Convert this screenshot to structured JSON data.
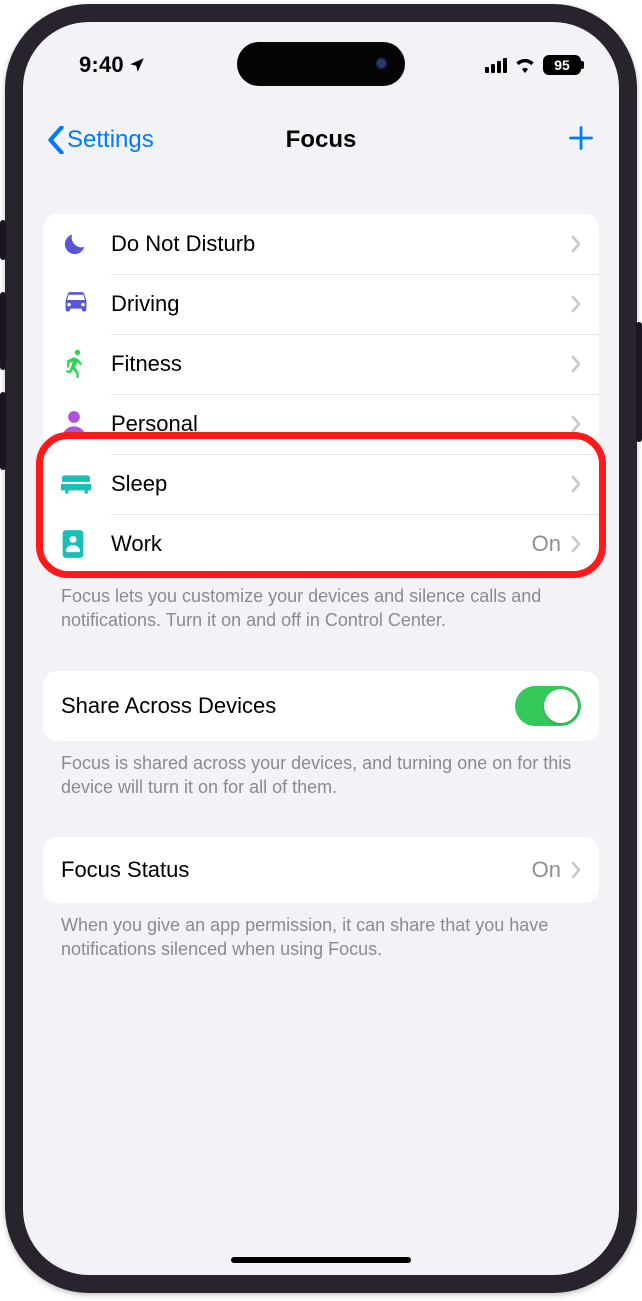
{
  "status": {
    "time": "9:40",
    "battery": "95"
  },
  "nav": {
    "back": "Settings",
    "title": "Focus"
  },
  "focus_list": [
    {
      "icon": "moon",
      "label": "Do Not Disturb",
      "detail": "",
      "color": "#5856d6"
    },
    {
      "icon": "car",
      "label": "Driving",
      "detail": "",
      "color": "#5856d6"
    },
    {
      "icon": "runner",
      "label": "Fitness",
      "detail": "",
      "color": "#30d158"
    },
    {
      "icon": "person",
      "label": "Personal",
      "detail": "",
      "color": "#af52de"
    },
    {
      "icon": "bed",
      "label": "Sleep",
      "detail": "",
      "color": "#19bfb6"
    },
    {
      "icon": "badge",
      "label": "Work",
      "detail": "On",
      "color": "#19bfb6"
    }
  ],
  "footer1": "Focus lets you customize your devices and silence calls and notifications. Turn it on and off in Control Center.",
  "share": {
    "label": "Share Across Devices",
    "enabled": true
  },
  "footer2": "Focus is shared across your devices, and turning one on for this device will turn it on for all of them.",
  "status_row": {
    "label": "Focus Status",
    "detail": "On"
  },
  "footer3": "When you give an app permission, it can share that you have notifications silenced when using Focus."
}
